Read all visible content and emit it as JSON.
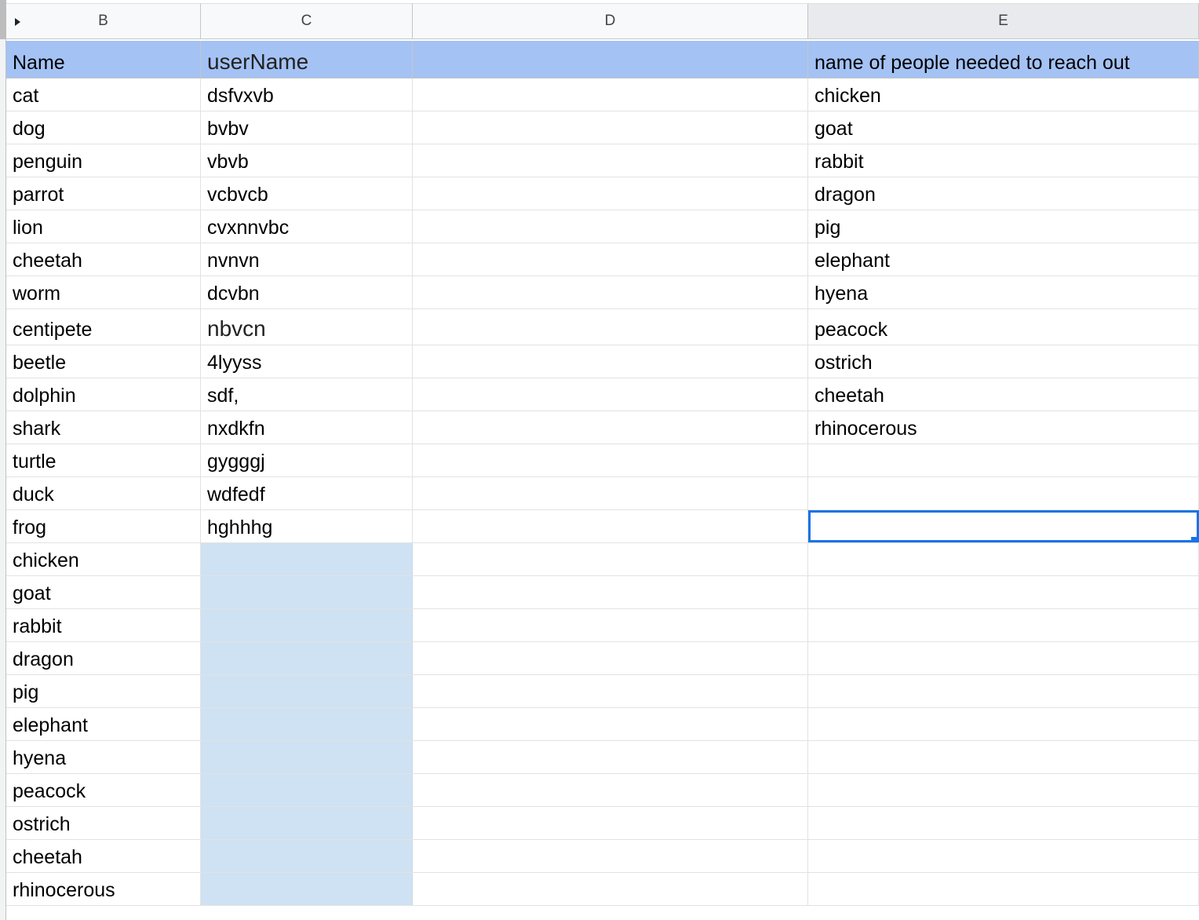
{
  "columns": [
    {
      "letter": "B"
    },
    {
      "letter": "C"
    },
    {
      "letter": "D"
    },
    {
      "letter": "E"
    }
  ],
  "header_row": {
    "B": "Name",
    "C": "userName",
    "D": "",
    "E": "name of people needed to reach out"
  },
  "rows": [
    {
      "B": "cat",
      "C": "dsfvxvb",
      "D": "",
      "E": "chicken"
    },
    {
      "B": "dog",
      "C": "bvbv",
      "D": "",
      "E": "goat"
    },
    {
      "B": "penguin",
      "C": "vbvb",
      "D": "",
      "E": "rabbit"
    },
    {
      "B": "parrot",
      "C": "vcbvcb",
      "D": "",
      "E": "dragon"
    },
    {
      "B": "lion",
      "C": "cvxnnvbc",
      "D": "",
      "E": "pig"
    },
    {
      "B": "cheetah",
      "C": "nvnvn",
      "D": "",
      "E": "elephant"
    },
    {
      "B": "worm",
      "C": "dcvbn",
      "D": "",
      "E": "hyena"
    },
    {
      "B": "centipete",
      "C": "nbvcn",
      "D": "",
      "E": "peacock"
    },
    {
      "B": "beetle",
      "C": "4lyyss",
      "D": "",
      "E": "ostrich"
    },
    {
      "B": "dolphin",
      "C": "sdf,",
      "D": "",
      "E": "cheetah"
    },
    {
      "B": "shark",
      "C": "nxdkfn",
      "D": "",
      "E": "rhinocerous"
    },
    {
      "B": "turtle",
      "C": "gygggj",
      "D": "",
      "E": ""
    },
    {
      "B": "duck",
      "C": "wdfedf",
      "D": "",
      "E": ""
    },
    {
      "B": "frog",
      "C": "hghhhg",
      "D": "",
      "E": ""
    },
    {
      "B": "chicken",
      "C": "",
      "D": "",
      "E": ""
    },
    {
      "B": "goat",
      "C": "",
      "D": "",
      "E": ""
    },
    {
      "B": "rabbit",
      "C": "",
      "D": "",
      "E": ""
    },
    {
      "B": "dragon",
      "C": "",
      "D": "",
      "E": ""
    },
    {
      "B": "pig",
      "C": "",
      "D": "",
      "E": ""
    },
    {
      "B": "elephant",
      "C": "",
      "D": "",
      "E": ""
    },
    {
      "B": "hyena",
      "C": "",
      "D": "",
      "E": ""
    },
    {
      "B": "peacock",
      "C": "",
      "D": "",
      "E": ""
    },
    {
      "B": "ostrich",
      "C": "",
      "D": "",
      "E": ""
    },
    {
      "B": "cheetah",
      "C": "",
      "D": "",
      "E": ""
    },
    {
      "B": "rhinocerous",
      "C": "",
      "D": "",
      "E": ""
    }
  ],
  "colors": {
    "header_row_fill": "#a4c2f4",
    "highlight_fill": "#cfe2f3",
    "selection_border": "#1a73e8"
  },
  "icons": {
    "column_group_toggle": "expand-arrow-icon"
  }
}
